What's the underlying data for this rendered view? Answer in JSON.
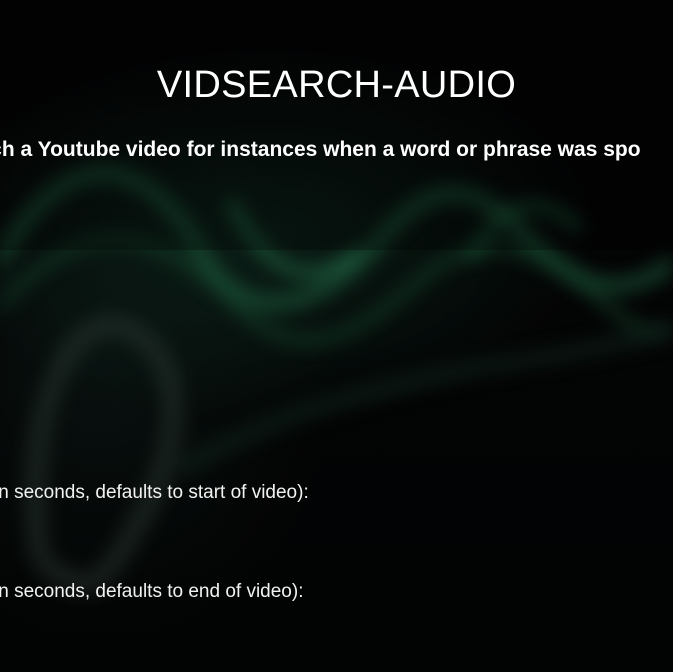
{
  "header": {
    "title": "VIDSEARCH-AUDIO",
    "subtitle": "rch a Youtube video for instances when a word or phrase was spo"
  },
  "form": {
    "start_label": "in seconds, defaults to start of video):",
    "end_label": "in seconds, defaults to end of video):"
  },
  "colors": {
    "background": "#030404",
    "accent_green": "#2e8f61",
    "text": "#ffffff"
  }
}
